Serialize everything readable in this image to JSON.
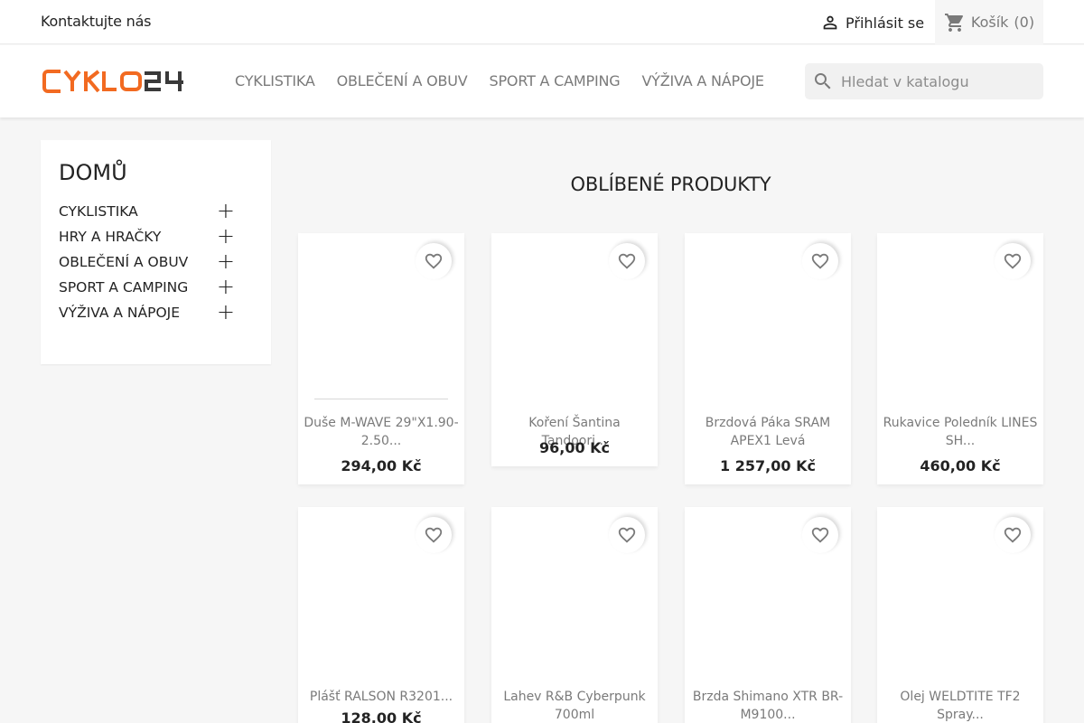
{
  "topbar": {
    "contact": "Kontaktujte nás",
    "login": "Přihlásit se",
    "cart_label": "Košík",
    "cart_count": "(0)"
  },
  "header": {
    "logo": "CYKLO24",
    "nav": [
      "CYKLISTIKA",
      "OBLEČENÍ A OBUV",
      "SPORT A CAMPING",
      "VÝŽIVA A NÁPOJE"
    ],
    "search_placeholder": "Hledat v katalogu"
  },
  "sidebar": {
    "title": "DOMŮ",
    "items": [
      "CYKLISTIKA",
      "HRY A HRAČKY",
      "OBLEČENÍ A OBUV",
      "SPORT A CAMPING",
      "VÝŽIVA A NÁPOJE"
    ],
    "expand_symbol": "+"
  },
  "main": {
    "title": "OBLÍBENÉ PRODUKTY",
    "products": [
      {
        "name": "Duše M-WAVE 29\"X1.90-2.50...",
        "price": "294,00 Kč"
      },
      {
        "name": "Koření Šantina Tandoori...",
        "price": "96,00 Kč"
      },
      {
        "name": "Brzdová Páka SRAM APEX1 Levá",
        "price": "1 257,00 Kč"
      },
      {
        "name": "Rukavice Poledník LINES SH...",
        "price": "460,00 Kč"
      },
      {
        "name": "Plášť RALSON R3201...",
        "price": "128,00 Kč"
      },
      {
        "name": "Lahev R&B Cyberpunk 700ml",
        "price": ""
      },
      {
        "name": "Brzda Shimano XTR BR-M9100...",
        "price": ""
      },
      {
        "name": "Olej WELDTITE TF2 Spray...",
        "price": ""
      }
    ]
  },
  "colors": {
    "brand_orange": "#f26a21",
    "brand_dark": "#3a3a3a",
    "text": "#232323",
    "muted": "#7a7a7a"
  },
  "icons": [
    "person-icon",
    "cart-icon",
    "search-icon",
    "heart-outline-icon"
  ]
}
